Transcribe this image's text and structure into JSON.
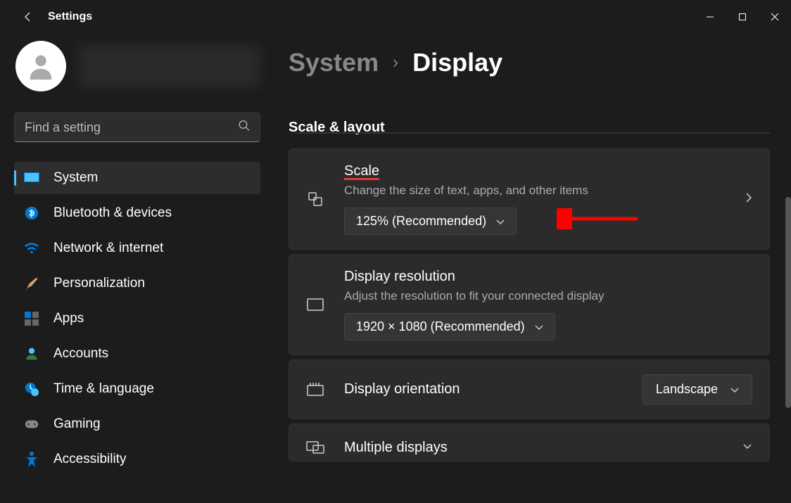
{
  "titlebar": {
    "app_title": "Settings"
  },
  "search": {
    "placeholder": "Find a setting"
  },
  "sidebar": {
    "items": [
      {
        "label": "System"
      },
      {
        "label": "Bluetooth & devices"
      },
      {
        "label": "Network & internet"
      },
      {
        "label": "Personalization"
      },
      {
        "label": "Apps"
      },
      {
        "label": "Accounts"
      },
      {
        "label": "Time & language"
      },
      {
        "label": "Gaming"
      },
      {
        "label": "Accessibility"
      }
    ]
  },
  "breadcrumb": {
    "parent": "System",
    "current": "Display"
  },
  "section": {
    "title": "Scale & layout"
  },
  "cards": {
    "scale": {
      "title": "Scale",
      "desc": "Change the size of text, apps, and other items",
      "value": "125% (Recommended)"
    },
    "resolution": {
      "title": "Display resolution",
      "desc": "Adjust the resolution to fit your connected display",
      "value": "1920 × 1080 (Recommended)"
    },
    "orientation": {
      "title": "Display orientation",
      "value": "Landscape"
    },
    "multiple": {
      "title": "Multiple displays"
    }
  }
}
